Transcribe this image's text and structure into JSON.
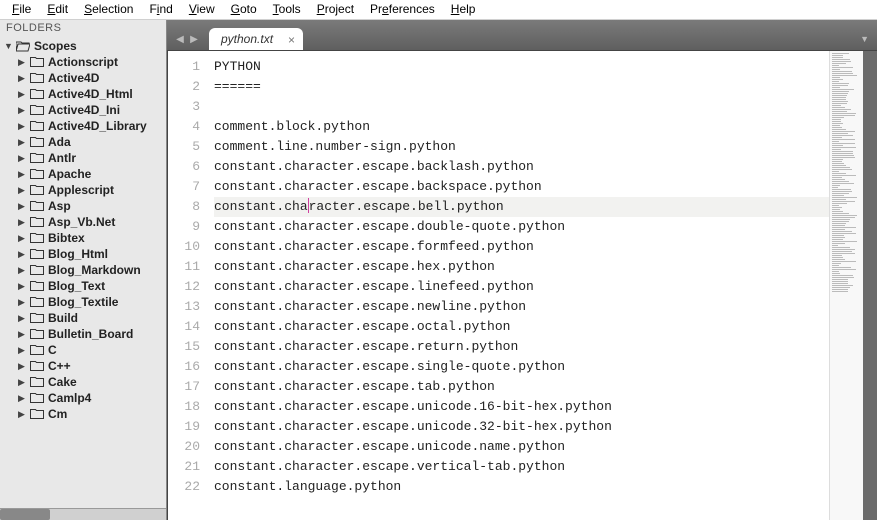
{
  "menubar": [
    {
      "label": "File",
      "accel": 0
    },
    {
      "label": "Edit",
      "accel": 0
    },
    {
      "label": "Selection",
      "accel": 0
    },
    {
      "label": "Find",
      "accel": 1
    },
    {
      "label": "View",
      "accel": 0
    },
    {
      "label": "Goto",
      "accel": 0
    },
    {
      "label": "Tools",
      "accel": 0
    },
    {
      "label": "Project",
      "accel": 0
    },
    {
      "label": "Preferences",
      "accel": 2
    },
    {
      "label": "Help",
      "accel": 0
    }
  ],
  "sidebar": {
    "header": "FOLDERS",
    "root": {
      "label": "Scopes",
      "expanded": true
    },
    "children": [
      "Actionscript",
      "Active4D",
      "Active4D_Html",
      "Active4D_Ini",
      "Active4D_Library",
      "Ada",
      "Antlr",
      "Apache",
      "Applescript",
      "Asp",
      "Asp_Vb.Net",
      "Bibtex",
      "Blog_Html",
      "Blog_Markdown",
      "Blog_Text",
      "Blog_Textile",
      "Build",
      "Bulletin_Board",
      "C",
      "C++",
      "Cake",
      "Camlp4",
      "Cm"
    ]
  },
  "tabs": {
    "active": {
      "label": "python.txt"
    }
  },
  "editor": {
    "highlighted_line_index": 7,
    "cursor": {
      "line_index": 7,
      "col": 12
    },
    "lines": [
      "PYTHON",
      "======",
      "",
      "comment.block.python",
      "comment.line.number-sign.python",
      "constant.character.escape.backlash.python",
      "constant.character.escape.backspace.python",
      "constant.character.escape.bell.python",
      "constant.character.escape.double-quote.python",
      "constant.character.escape.formfeed.python",
      "constant.character.escape.hex.python",
      "constant.character.escape.linefeed.python",
      "constant.character.escape.newline.python",
      "constant.character.escape.octal.python",
      "constant.character.escape.return.python",
      "constant.character.escape.single-quote.python",
      "constant.character.escape.tab.python",
      "constant.character.escape.unicode.16-bit-hex.python",
      "constant.character.escape.unicode.32-bit-hex.python",
      "constant.character.escape.unicode.name.python",
      "constant.character.escape.vertical-tab.python",
      "constant.language.python"
    ]
  }
}
